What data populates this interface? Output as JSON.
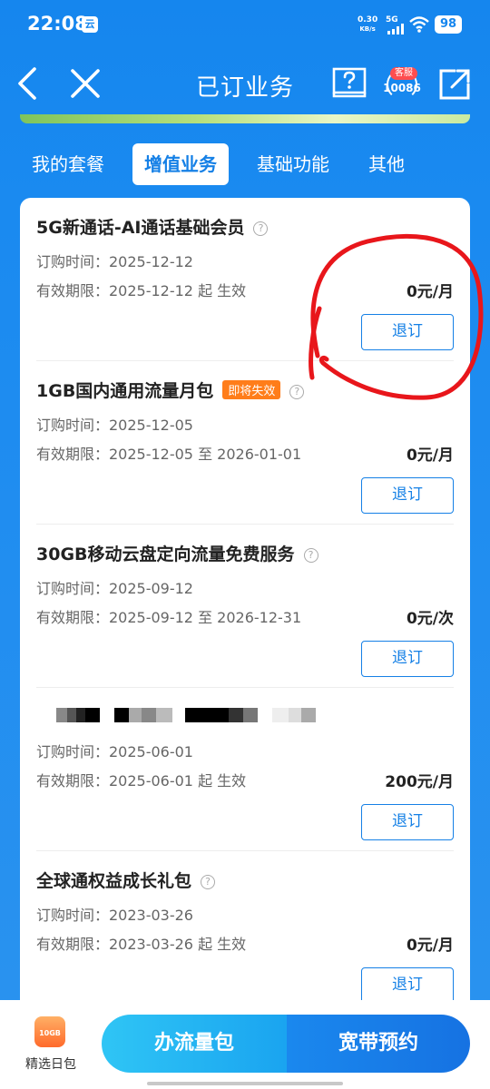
{
  "status_bar": {
    "time": "22:08",
    "app_icon": "云",
    "speed_value": "0.30",
    "speed_unit": "KB/s",
    "network": "5G",
    "battery": "98",
    "icons": [
      "signal-icon",
      "wifi-icon",
      "battery-icon"
    ]
  },
  "header": {
    "title": "已订业务",
    "service_badge": "客服",
    "service_number": "10086",
    "icons": [
      "back-icon",
      "close-icon",
      "help-book-icon",
      "customer-service-icon",
      "share-icon"
    ]
  },
  "tabs": [
    {
      "label": "我的套餐",
      "active": false
    },
    {
      "label": "增值业务",
      "active": true
    },
    {
      "label": "基础功能",
      "active": false
    },
    {
      "label": "其他",
      "active": false
    }
  ],
  "services": [
    {
      "title": "5G新通话-AI通话基础会员",
      "badge": "",
      "order_time": "订购时间：2025-12-12",
      "valid_period": "有效期限：2025-12-12 起 生效",
      "price": "0元/月",
      "button": "退订"
    },
    {
      "title": "1GB国内通用流量月包",
      "badge": "即将失效",
      "order_time": "订购时间：2025-12-05",
      "valid_period": "有效期限：2025-12-05 至 2026-01-01",
      "price": "0元/月",
      "button": "退订"
    },
    {
      "title": "30GB移动云盘定向流量免费服务",
      "badge": "",
      "order_time": "订购时间：2025-09-12",
      "valid_period": "有效期限：2025-09-12 至 2026-12-31",
      "price": "0元/次",
      "button": "退订"
    },
    {
      "title": "",
      "badge": "",
      "order_time": "订购时间：2025-06-01",
      "valid_period": "有效期限：2025-06-01 起 生效",
      "price": "200元/月",
      "button": "退订"
    },
    {
      "title": "全球通权益成长礼包",
      "badge": "",
      "order_time": "订购时间：2023-03-26",
      "valid_period": "有效期限：2023-03-26 起 生效",
      "price": "0元/月",
      "button": "退订"
    }
  ],
  "help_glyph": "?",
  "bottom_bar": {
    "daily_pick_icon_text": "10GB",
    "daily_pick_label": "精选日包",
    "traffic_button": "办流量包",
    "broadband_button": "宽带预约"
  },
  "colors": {
    "primary_blue": "#1580e6",
    "expire_badge": "#ff7d1a",
    "annotation_red": "#e8161b"
  }
}
